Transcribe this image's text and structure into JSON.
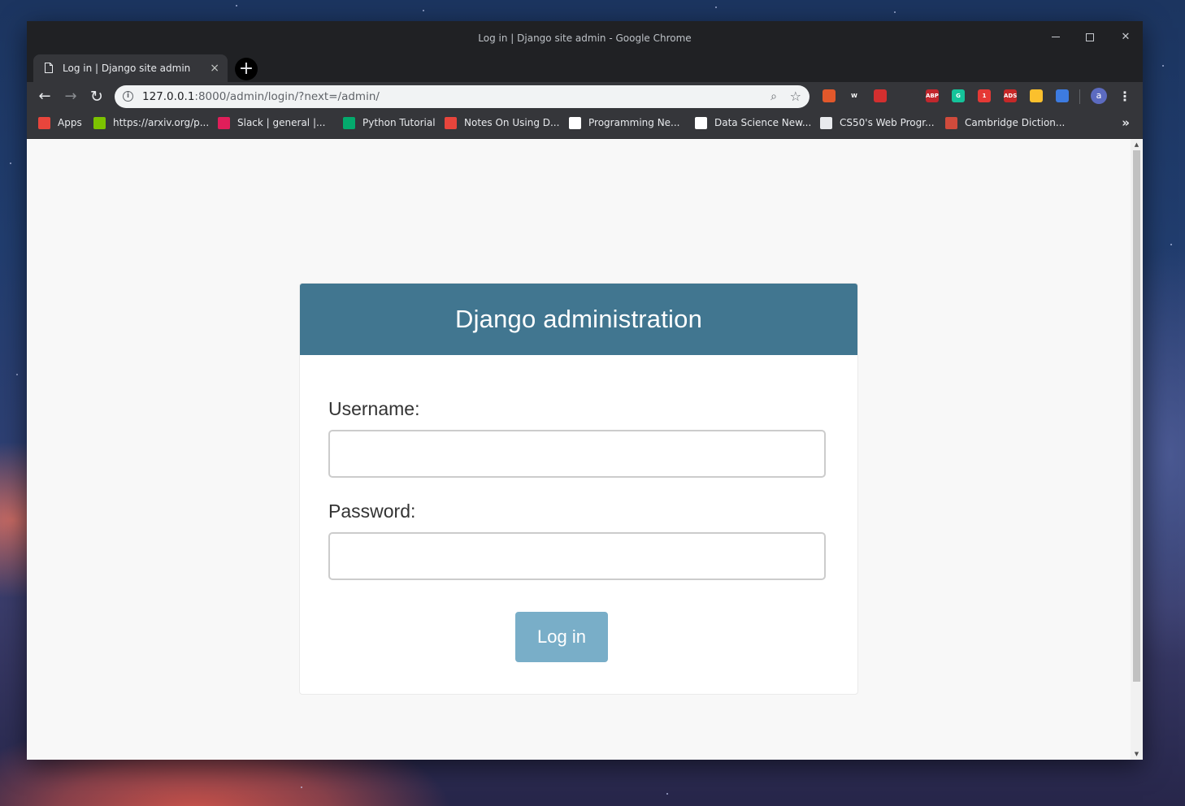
{
  "browser": {
    "window_title": "Log in | Django site admin - Google Chrome",
    "tab": {
      "title": "Log in | Django site admin",
      "close": "×"
    },
    "new_tab": "+",
    "address": {
      "host": "127.0.0.1",
      "rest": ":8000/admin/login/?next=/admin/"
    },
    "profile_initial": "a",
    "bookmarks": [
      {
        "label": "Apps",
        "icon": "apps-grid-icon",
        "color": "#e8453c"
      },
      {
        "label": "https://arxiv.org/p...",
        "icon": "arxiv-icon",
        "color": "#7cc200"
      },
      {
        "label": "Slack | general |...",
        "icon": "slack-icon",
        "color": "#e01e5a"
      },
      {
        "label": "Python Tutorial",
        "icon": "w3schools-icon",
        "color": "#04aa6d"
      },
      {
        "label": "Notes On Using D...",
        "icon": "notes-icon",
        "color": "#e8453c"
      },
      {
        "label": "Programming Ne...",
        "icon": "medium-icon",
        "color": "#ffffff"
      },
      {
        "label": "Data Science New...",
        "icon": "medium-icon",
        "color": "#ffffff"
      },
      {
        "label": "CS50's Web Progr...",
        "icon": "cs50-icon",
        "color": "#e8eaed"
      },
      {
        "label": "Cambridge Diction...",
        "icon": "cambridge-icon",
        "color": "#d04b3c"
      }
    ],
    "bookmarks_more": "»",
    "extensions": [
      {
        "name": "ext-bars-icon",
        "color": "#e2582b",
        "text": ""
      },
      {
        "name": "ext-w-icon",
        "color": "#35363a",
        "text": "W"
      },
      {
        "name": "ext-hand-icon",
        "color": "#d32f2f",
        "text": ""
      },
      {
        "name": "ext-fist-icon",
        "color": "#35363a",
        "text": ""
      },
      {
        "name": "ext-abp-icon",
        "color": "#c1272d",
        "text": "ABP"
      },
      {
        "name": "ext-grammarly-icon",
        "color": "#15c39a",
        "text": "G"
      },
      {
        "name": "ext-badge-icon",
        "color": "#e53935",
        "text": "1"
      },
      {
        "name": "ext-ads-icon",
        "color": "#c62828",
        "text": "ADS"
      },
      {
        "name": "ext-color-icon",
        "color": "#fbc02d",
        "text": ""
      },
      {
        "name": "ext-window-icon",
        "color": "#3d7be0",
        "text": ""
      }
    ]
  },
  "page": {
    "header": "Django administration",
    "username_label": "Username:",
    "password_label": "Password:",
    "username_value": "",
    "password_value": "",
    "submit_label": "Log in"
  },
  "colors": {
    "header_bg": "#417690",
    "button_bg": "#79aec8",
    "page_bg": "#f8f8f8"
  }
}
